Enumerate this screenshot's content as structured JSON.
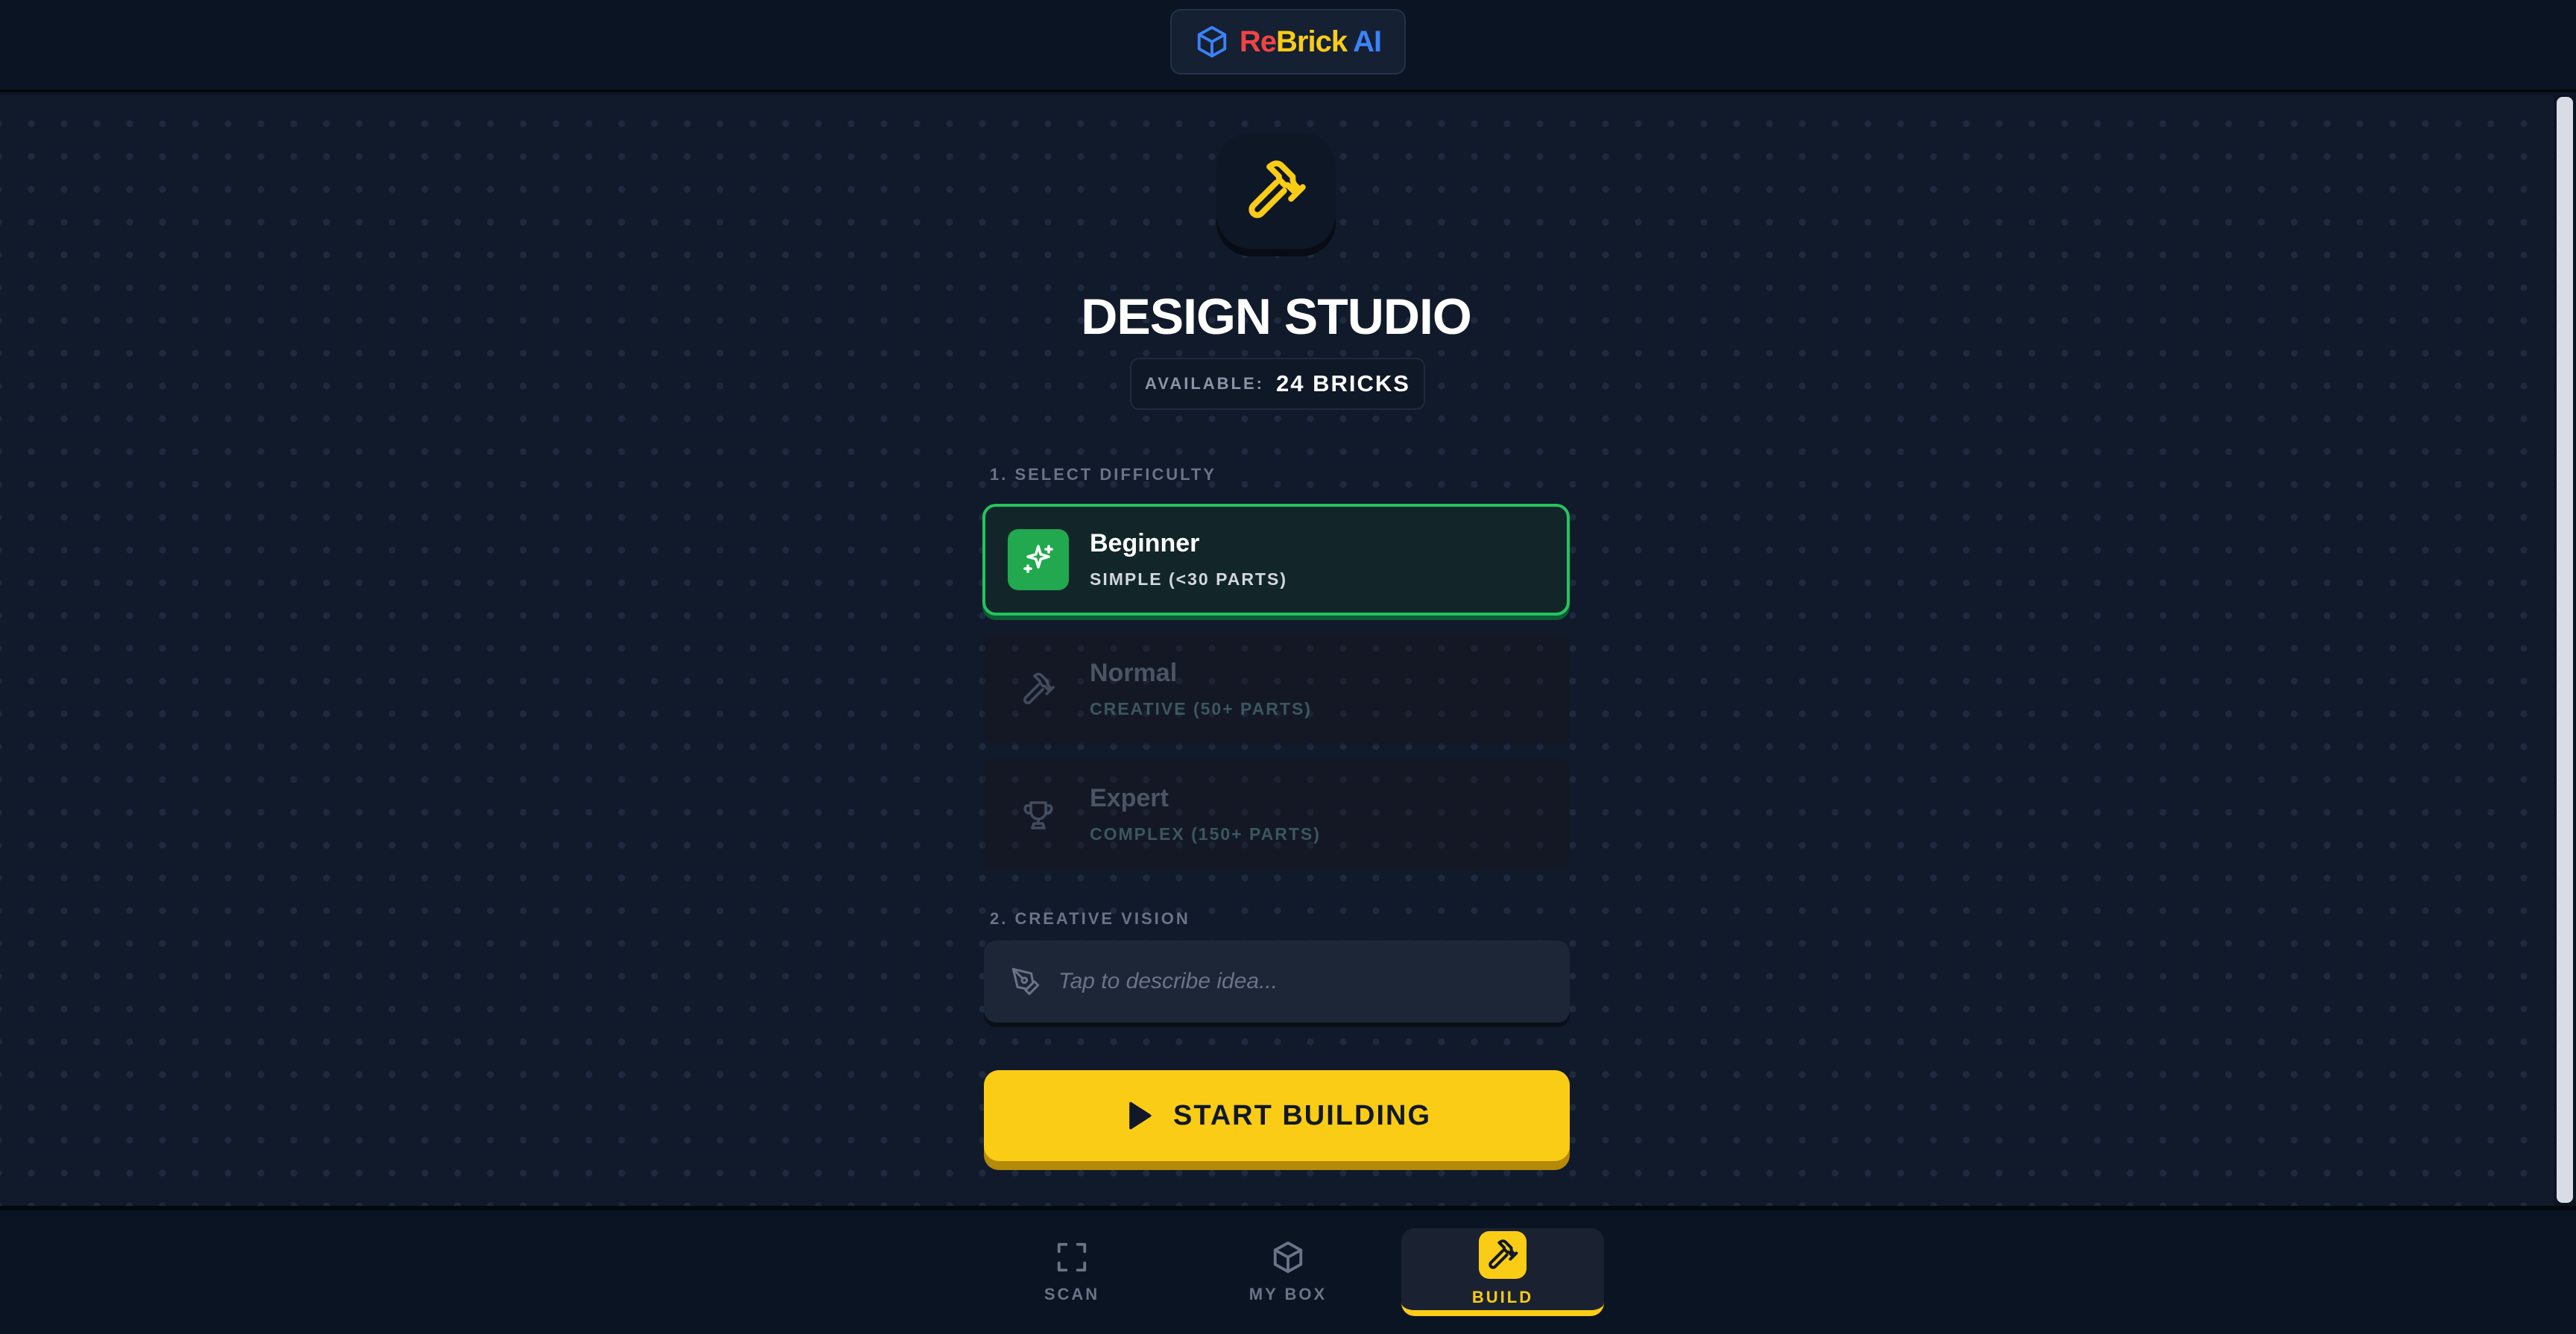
{
  "brand": {
    "part1": "Re",
    "part2": "Brick",
    "part3": "AI",
    "logo_icon": "cube-icon",
    "colors": {
      "re": "#ef4444",
      "brick": "#facc15",
      "ai": "#3b82f6"
    }
  },
  "hero": {
    "icon": "hammer-icon",
    "title": "DESIGN STUDIO",
    "available_label": "AVAILABLE:",
    "available_value": "24 BRICKS"
  },
  "difficulty": {
    "section_label": "1. SELECT DIFFICULTY",
    "options": [
      {
        "name": "Beginner",
        "subtitle": "SIMPLE (<30 PARTS)",
        "icon": "sparkles-icon",
        "selected": true
      },
      {
        "name": "Normal",
        "subtitle": "CREATIVE (50+ PARTS)",
        "icon": "hammer-icon",
        "selected": false
      },
      {
        "name": "Expert",
        "subtitle": "COMPLEX (150+ PARTS)",
        "icon": "trophy-icon",
        "selected": false
      }
    ]
  },
  "vision": {
    "section_label": "2. CREATIVE VISION",
    "placeholder": "Tap to describe idea...",
    "value": "",
    "icon": "pen-tool-icon"
  },
  "actions": {
    "start_label": "START BUILDING",
    "start_icon": "play-icon"
  },
  "nav": {
    "items": [
      {
        "label": "SCAN",
        "icon": "scan-icon",
        "active": false
      },
      {
        "label": "MY BOX",
        "icon": "box-icon",
        "active": false
      },
      {
        "label": "BUILD",
        "icon": "hammer-icon",
        "active": true
      }
    ]
  },
  "colors": {
    "accent_yellow": "#facc15",
    "accent_green": "#22c55e",
    "background": "#101a2b"
  }
}
